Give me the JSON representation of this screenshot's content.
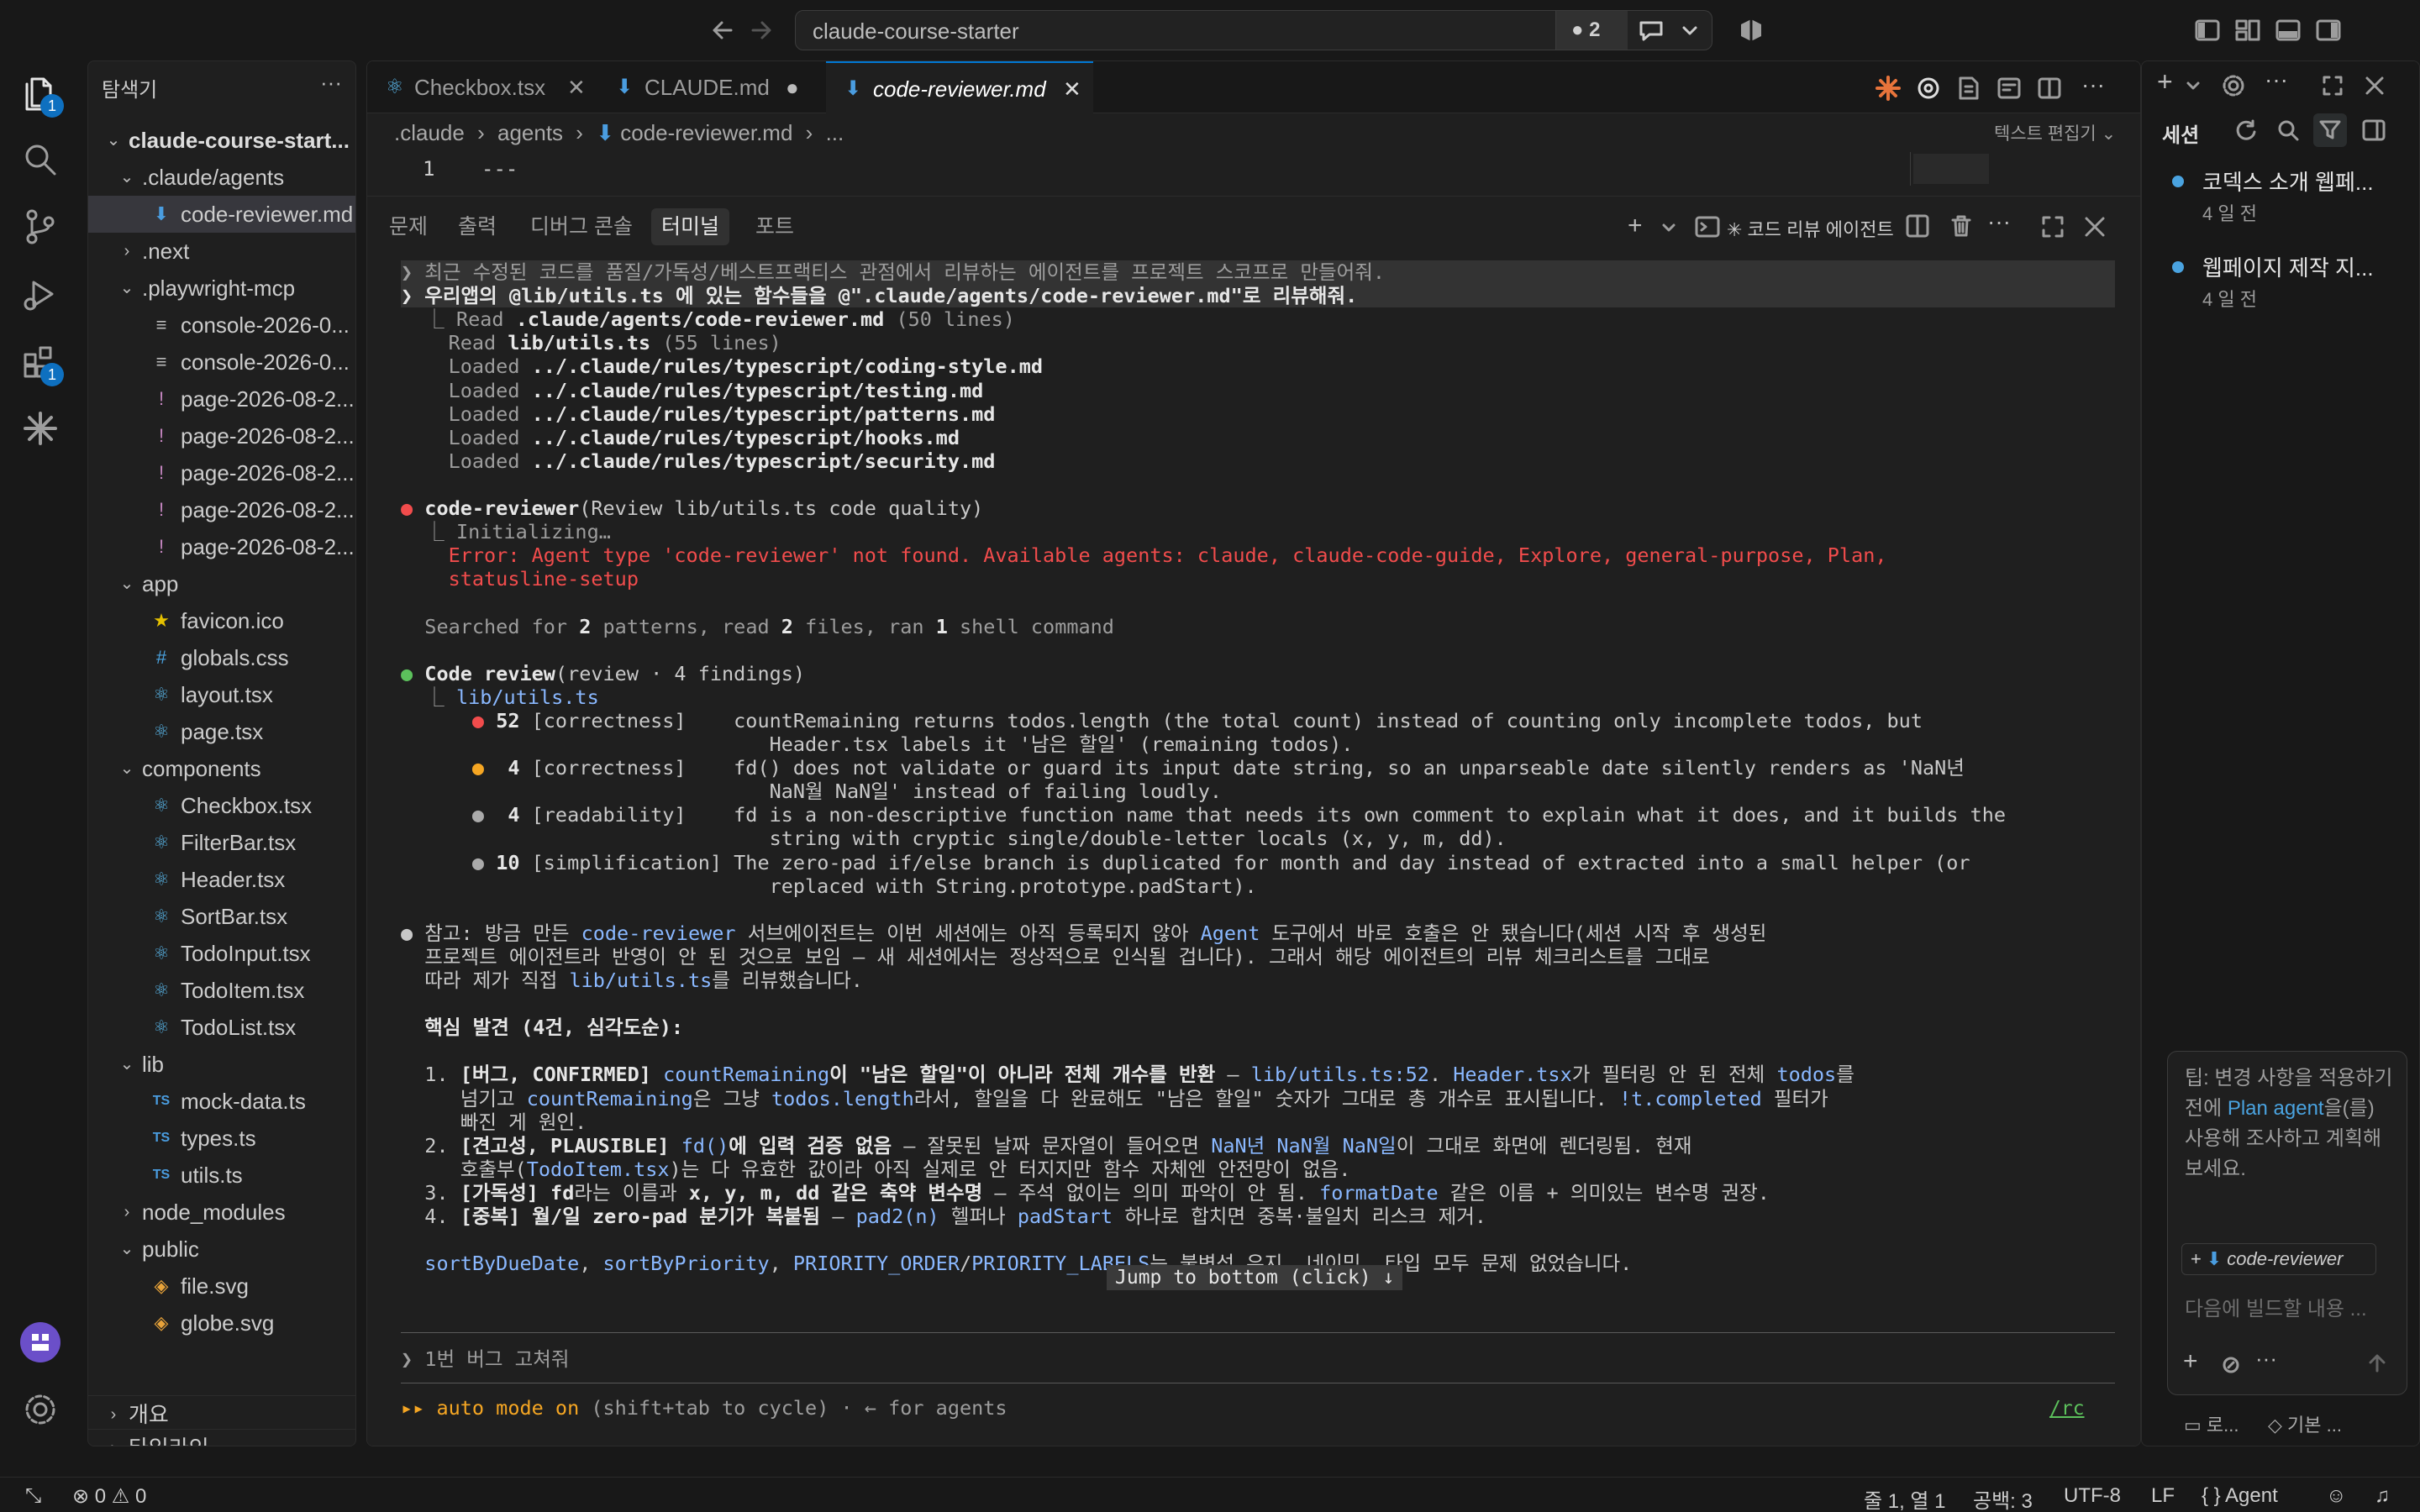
{
  "titlebar": {
    "search_text": "claude-course-starter",
    "dirty_count": "2"
  },
  "activity": {
    "explorer_badge": "1",
    "extensions_badge": "1"
  },
  "sidebar": {
    "title": "탐색기",
    "project": "claude-course-start...",
    "tree": [
      {
        "label": ".claude/agents",
        "depth": 1,
        "kind": "folder-open"
      },
      {
        "label": "code-reviewer.md",
        "depth": 2,
        "kind": "md",
        "selected": true
      },
      {
        "label": ".next",
        "depth": 1,
        "kind": "folder"
      },
      {
        "label": ".playwright-mcp",
        "depth": 1,
        "kind": "folder-open"
      },
      {
        "label": "console-2026-0...",
        "depth": 2,
        "kind": "log"
      },
      {
        "label": "console-2026-0...",
        "depth": 2,
        "kind": "log"
      },
      {
        "label": "page-2026-08-2...",
        "depth": 2,
        "kind": "yml"
      },
      {
        "label": "page-2026-08-2...",
        "depth": 2,
        "kind": "yml"
      },
      {
        "label": "page-2026-08-2...",
        "depth": 2,
        "kind": "yml"
      },
      {
        "label": "page-2026-08-2...",
        "depth": 2,
        "kind": "yml"
      },
      {
        "label": "page-2026-08-2...",
        "depth": 2,
        "kind": "yml"
      },
      {
        "label": "app",
        "depth": 1,
        "kind": "folder-open"
      },
      {
        "label": "favicon.ico",
        "depth": 2,
        "kind": "ico"
      },
      {
        "label": "globals.css",
        "depth": 2,
        "kind": "css"
      },
      {
        "label": "layout.tsx",
        "depth": 2,
        "kind": "tsx"
      },
      {
        "label": "page.tsx",
        "depth": 2,
        "kind": "tsx"
      },
      {
        "label": "components",
        "depth": 1,
        "kind": "folder-open"
      },
      {
        "label": "Checkbox.tsx",
        "depth": 2,
        "kind": "tsx"
      },
      {
        "label": "FilterBar.tsx",
        "depth": 2,
        "kind": "tsx"
      },
      {
        "label": "Header.tsx",
        "depth": 2,
        "kind": "tsx"
      },
      {
        "label": "SortBar.tsx",
        "depth": 2,
        "kind": "tsx"
      },
      {
        "label": "TodoInput.tsx",
        "depth": 2,
        "kind": "tsx"
      },
      {
        "label": "TodoItem.tsx",
        "depth": 2,
        "kind": "tsx"
      },
      {
        "label": "TodoList.tsx",
        "depth": 2,
        "kind": "tsx"
      },
      {
        "label": "lib",
        "depth": 1,
        "kind": "folder-open"
      },
      {
        "label": "mock-data.ts",
        "depth": 2,
        "kind": "ts"
      },
      {
        "label": "types.ts",
        "depth": 2,
        "kind": "ts"
      },
      {
        "label": "utils.ts",
        "depth": 2,
        "kind": "ts"
      },
      {
        "label": "node_modules",
        "depth": 1,
        "kind": "folder"
      },
      {
        "label": "public",
        "depth": 1,
        "kind": "folder-open"
      },
      {
        "label": "file.svg",
        "depth": 2,
        "kind": "svg"
      },
      {
        "label": "globe.svg",
        "depth": 2,
        "kind": "svg"
      }
    ],
    "outline": "개요",
    "timeline": "타임라인"
  },
  "editor": {
    "tabs": [
      {
        "label": "Checkbox.tsx",
        "icon": "react-icon"
      },
      {
        "label": "CLAUDE.md",
        "icon": "markdown-icon",
        "dirty": true
      },
      {
        "label": "code-reviewer.md",
        "icon": "markdown-icon",
        "active": true
      }
    ],
    "breadcrumb": [
      ".claude",
      "agents",
      "code-reviewer.md",
      "..."
    ],
    "edit_mode": "텍스트 편집기",
    "line_no": "1",
    "line_text": "---"
  },
  "panel": {
    "tabs": [
      "문제",
      "출력",
      "디버그 콘솔",
      "터미널",
      "포트"
    ],
    "active_tab": "터미널",
    "terminal_name": "✳ 코드 리뷰 에이전트",
    "lines": [
      {
        "y": 0,
        "hl": true,
        "segs": [
          [
            "❯ 최근 수정된 코드를 품질/가독성/베스트프랙티스 관점에서 리뷰하는 에이전트를 프로젝트 스코프로 만들어줘.",
            "dim"
          ]
        ]
      },
      {
        "y": 1,
        "hl": true,
        "segs": [
          [
            "❯ 우리앱의 @lib/utils.ts 에 있는 함수들을 @\".claude/agents/code-reviewer.md\"로 리뷰해줘.",
            "b"
          ]
        ]
      },
      {
        "y": 2,
        "segs": [
          [
            "  ⎿ Read ",
            "dim"
          ],
          [
            ".claude/agents/code-reviewer.md",
            "b"
          ],
          [
            " (50 lines)",
            "dim"
          ]
        ]
      },
      {
        "y": 3,
        "segs": [
          [
            "    Read ",
            "dim"
          ],
          [
            "lib/utils.ts",
            "b"
          ],
          [
            " (55 lines)",
            "dim"
          ]
        ]
      },
      {
        "y": 4,
        "segs": [
          [
            "    Loaded ",
            "dim"
          ],
          [
            "../.claude/rules/typescript/coding-style.md",
            "b"
          ]
        ]
      },
      {
        "y": 5,
        "segs": [
          [
            "    Loaded ",
            "dim"
          ],
          [
            "../.claude/rules/typescript/testing.md",
            "b"
          ]
        ]
      },
      {
        "y": 6,
        "segs": [
          [
            "    Loaded ",
            "dim"
          ],
          [
            "../.claude/rules/typescript/patterns.md",
            "b"
          ]
        ]
      },
      {
        "y": 7,
        "segs": [
          [
            "    Loaded ",
            "dim"
          ],
          [
            "../.claude/rules/typescript/hooks.md",
            "b"
          ]
        ]
      },
      {
        "y": 8,
        "segs": [
          [
            "    Loaded ",
            "dim"
          ],
          [
            "../.claude/rules/typescript/security.md",
            "b"
          ]
        ]
      },
      {
        "y": 10,
        "segs": [
          [
            "● ",
            "red"
          ],
          [
            "code-reviewer",
            "b"
          ],
          [
            "(Review lib/utils.ts code quality)",
            ""
          ]
        ]
      },
      {
        "y": 11,
        "segs": [
          [
            "  ⎿ Initializing…",
            "dim"
          ]
        ]
      },
      {
        "y": 12,
        "segs": [
          [
            "    Error: Agent type 'code-reviewer' not found. Available agents: claude, claude-code-guide, Explore, general-purpose, Plan,",
            "red"
          ]
        ]
      },
      {
        "y": 13,
        "segs": [
          [
            "    statusline-setup",
            "red"
          ]
        ]
      },
      {
        "y": 15,
        "segs": [
          [
            "  Searched for ",
            "dim"
          ],
          [
            "2",
            "b"
          ],
          [
            " patterns, read ",
            "dim"
          ],
          [
            "2",
            "b"
          ],
          [
            " files, ran ",
            "dim"
          ],
          [
            "1",
            "b"
          ],
          [
            " shell command",
            "dim"
          ]
        ]
      },
      {
        "y": 17,
        "segs": [
          [
            "● ",
            "grn"
          ],
          [
            "Code review",
            "b"
          ],
          [
            "(review · 4 findings)",
            ""
          ]
        ]
      },
      {
        "y": 18,
        "segs": [
          [
            "  ⎿ ",
            "dim"
          ],
          [
            "lib/utils.ts",
            "blue"
          ]
        ]
      },
      {
        "y": 19,
        "segs": [
          [
            "      ● ",
            "red"
          ],
          [
            "52",
            "b"
          ],
          [
            " [correctness]    countRemaining returns todos.length (the total count) instead of counting only incomplete todos, but",
            ""
          ]
        ]
      },
      {
        "y": 20,
        "segs": [
          [
            "                               Header.tsx labels it '남은 할일' (remaining todos).",
            ""
          ]
        ]
      },
      {
        "y": 21,
        "segs": [
          [
            "      ● ",
            "ora"
          ],
          [
            " 4",
            "b"
          ],
          [
            " [correctness]    fd() does not validate or guard its input date string, so an unparseable date silently renders as 'NaN년",
            ""
          ]
        ]
      },
      {
        "y": 22,
        "segs": [
          [
            "                               NaN월 NaN일' instead of failing loudly.",
            ""
          ]
        ]
      },
      {
        "y": 23,
        "segs": [
          [
            "      ● ",
            "gry"
          ],
          [
            " 4",
            "b"
          ],
          [
            " [readability]    fd is a non-descriptive function name that needs its own comment to explain what it does, and it builds the",
            ""
          ]
        ]
      },
      {
        "y": 24,
        "segs": [
          [
            "                               string with cryptic single/double-letter locals (x, y, m, dd).",
            ""
          ]
        ]
      },
      {
        "y": 25,
        "segs": [
          [
            "      ● ",
            "gry"
          ],
          [
            "10",
            "b"
          ],
          [
            " [simplification] The zero-pad if/else branch is duplicated for month and day instead of extracted into a small helper (or",
            ""
          ]
        ]
      },
      {
        "y": 26,
        "segs": [
          [
            "                               replaced with String.prototype.padStart).",
            ""
          ]
        ]
      },
      {
        "y": 28,
        "segs": [
          [
            "● 참고: 방금 만든 ",
            ""
          ],
          [
            "code-reviewer",
            "blue"
          ],
          [
            " 서브에이전트는 이번 세션에는 아직 등록되지 않아 ",
            ""
          ],
          [
            "Agent",
            "blue"
          ],
          [
            " 도구에서 바로 호출은 안 됐습니다(세션 시작 후 생성된",
            ""
          ]
        ]
      },
      {
        "y": 29,
        "segs": [
          [
            "  프로젝트 에이전트라 반영이 안 된 것으로 보임 — 새 세션에서는 정상적으로 인식될 겁니다). 그래서 해당 에이전트의 리뷰 체크리스트를 그대로",
            ""
          ]
        ]
      },
      {
        "y": 30,
        "segs": [
          [
            "  따라 제가 직접 ",
            ""
          ],
          [
            "lib/utils.ts",
            "blue"
          ],
          [
            "를 리뷰했습니다.",
            ""
          ]
        ]
      },
      {
        "y": 32,
        "segs": [
          [
            "  핵심 발견 (4건, 심각도순):",
            "b"
          ]
        ]
      },
      {
        "y": 34,
        "segs": [
          [
            "  1. ",
            ""
          ],
          [
            "[버그, CONFIRMED] ",
            "b"
          ],
          [
            "countRemaining",
            "blue"
          ],
          [
            "이 \"남은 할일\"이 아니라 전체 개수를 반환",
            "b"
          ],
          [
            " — ",
            ""
          ],
          [
            "lib/utils.ts:52",
            "blue"
          ],
          [
            ". ",
            ""
          ],
          [
            "Header.tsx",
            "blue"
          ],
          [
            "가 필터링 안 된 전체 ",
            ""
          ],
          [
            "todos",
            "blue"
          ],
          [
            "를",
            ""
          ]
        ]
      },
      {
        "y": 35,
        "segs": [
          [
            "     넘기고 ",
            ""
          ],
          [
            "countRemaining",
            "blue"
          ],
          [
            "은 그냥 ",
            ""
          ],
          [
            "todos.length",
            "blue"
          ],
          [
            "라서, 할일을 다 완료해도 \"남은 할일\" 숫자가 그대로 총 개수로 표시됩니다. ",
            ""
          ],
          [
            "!t.completed",
            "blue"
          ],
          [
            " 필터가",
            ""
          ]
        ]
      },
      {
        "y": 36,
        "segs": [
          [
            "     빠진 게 원인.",
            ""
          ]
        ]
      },
      {
        "y": 37,
        "segs": [
          [
            "  2. ",
            ""
          ],
          [
            "[견고성, PLAUSIBLE] ",
            "b"
          ],
          [
            "fd()",
            "blue"
          ],
          [
            "에 입력 검증 없음",
            "b"
          ],
          [
            " — 잘못된 날짜 문자열이 들어오면 ",
            ""
          ],
          [
            "NaN년 NaN월 NaN일",
            "blue"
          ],
          [
            "이 그대로 화면에 렌더링됨. 현재",
            ""
          ]
        ]
      },
      {
        "y": 38,
        "segs": [
          [
            "     호출부(",
            ""
          ],
          [
            "TodoItem.tsx",
            "blue"
          ],
          [
            ")는 다 유효한 값이라 아직 실제로 안 터지지만 함수 자체엔 안전망이 없음.",
            ""
          ]
        ]
      },
      {
        "y": 39,
        "segs": [
          [
            "  3. ",
            ""
          ],
          [
            "[가독성] fd",
            "b"
          ],
          [
            "라는 이름과 ",
            ""
          ],
          [
            "x, y, m, dd",
            "b"
          ],
          [
            " 같은 축약 변수명",
            "b"
          ],
          [
            " — 주석 없이는 의미 파악이 안 됨. ",
            ""
          ],
          [
            "formatDate",
            "blue"
          ],
          [
            " 같은 이름 + 의미있는 변수명 권장.",
            ""
          ]
        ]
      },
      {
        "y": 40,
        "segs": [
          [
            "  4. ",
            ""
          ],
          [
            "[중복] 월/일 zero-pad 분기가 복붙됨",
            "b"
          ],
          [
            " — ",
            ""
          ],
          [
            "pad2(n)",
            "blue"
          ],
          [
            " 헬퍼나 ",
            ""
          ],
          [
            "padStart",
            "blue"
          ],
          [
            " 하나로 합치면 중복·불일치 리스크 제거.",
            ""
          ]
        ]
      },
      {
        "y": 42,
        "segs": [
          [
            "  ",
            ""
          ],
          [
            "sortByDueDate",
            "blue"
          ],
          [
            ", ",
            ""
          ],
          [
            "sortByPriority",
            "blue"
          ],
          [
            ", ",
            ""
          ],
          [
            "PRIORITY_ORDER",
            "blue"
          ],
          [
            "/",
            ""
          ],
          [
            "PRIORITY_LABELS",
            "blue"
          ],
          [
            "는 불변성 유지, 네이밍, 타입 모두 문제 없었습니다.",
            ""
          ]
        ]
      }
    ],
    "jump_label": "Jump to bottom (click) ↓",
    "prompt_text": "1번 버그 고쳐줘",
    "mode_label": "▸▸ auto mode on",
    "mode_hint": " (shift+tab to cycle) · ← for agents",
    "rc_label": "/rc"
  },
  "chat": {
    "title": "세션",
    "sessions": [
      {
        "title": "코덱스 소개 웹페...",
        "time": "4 일 전"
      },
      {
        "title": "웹페이지 제작 지...",
        "time": "4 일 전"
      }
    ],
    "tip_prefix": "팁: 변경 사항을 적용하기 전에 ",
    "tip_link": "Plan agent",
    "tip_suffix": "을(를) 사용해 조사하고 계획해 보세요.",
    "context_chip": "code-reviewer",
    "input_placeholder": "다음에 빌드할 내용 ...",
    "bottom_left": "로...",
    "bottom_right": "기본 ..."
  },
  "status": {
    "errors": "0",
    "warnings": "0",
    "position": "줄 1, 열 1",
    "spaces": "공백: 3",
    "encoding": "UTF-8",
    "eol": "LF",
    "language": "Agent"
  },
  "colors": {
    "accent": "#0078d4",
    "error": "#f14c4c",
    "link": "#8ab8ff",
    "warning": "#f5a623"
  }
}
